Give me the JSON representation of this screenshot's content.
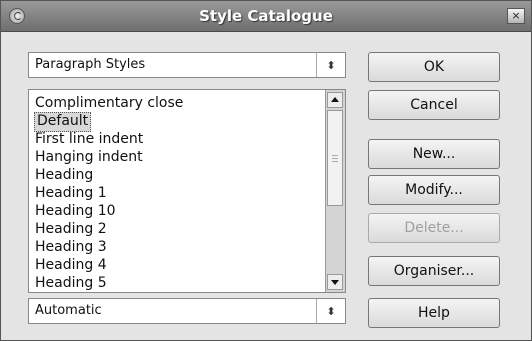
{
  "window": {
    "title": "Style Catalogue",
    "close_glyph": "×",
    "menu_icon": "window-menu-icon"
  },
  "style_type_select": {
    "value": "Paragraph Styles",
    "spin_glyph": "⬍"
  },
  "filter_select": {
    "value": "Automatic",
    "spin_glyph": "⬍"
  },
  "styles_list": {
    "items": [
      "Complimentary close",
      "Default",
      "First line indent",
      "Hanging indent",
      "Heading",
      "Heading 1",
      "Heading 10",
      "Heading 2",
      "Heading 3",
      "Heading 4",
      "Heading 5"
    ],
    "selected_index": 1,
    "scroll_position": 0.0
  },
  "buttons": {
    "ok": "OK",
    "cancel": "Cancel",
    "new": "New...",
    "modify": "Modify...",
    "delete": "Delete...",
    "organiser": "Organiser...",
    "help": "Help"
  }
}
